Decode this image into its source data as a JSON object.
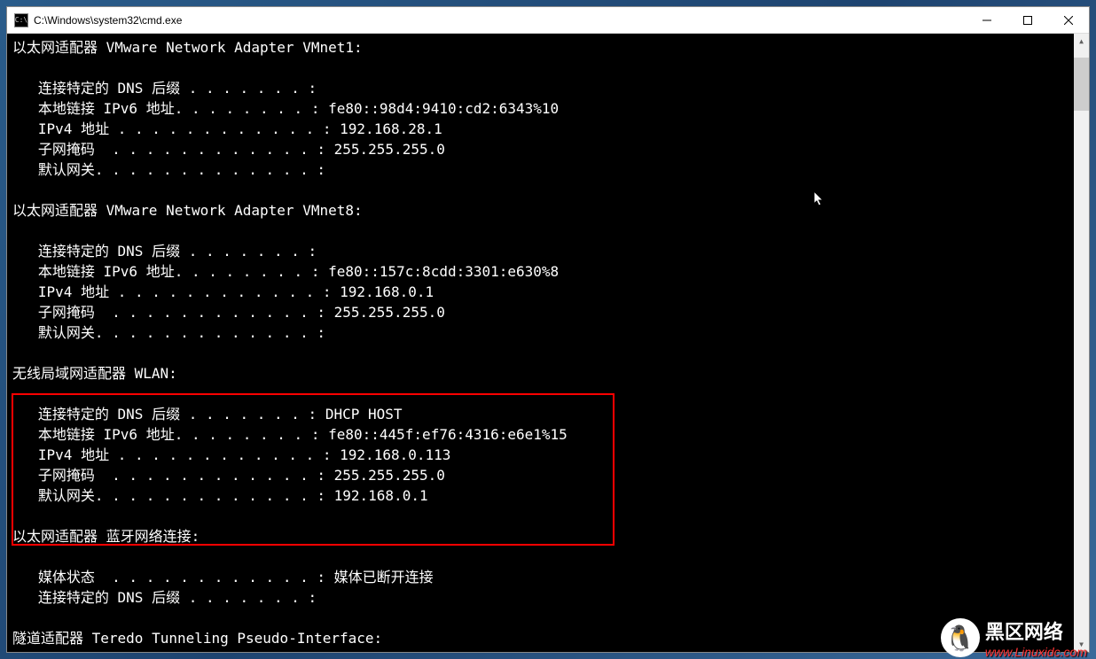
{
  "window": {
    "title": "C:\\Windows\\system32\\cmd.exe",
    "icon_label": "C:\\"
  },
  "terminal": {
    "adapter1": {
      "header": "以太网适配器 VMware Network Adapter VMnet1:",
      "dns_suffix_label": "   连接特定的 DNS 后缀 . . . . . . . :",
      "ipv6_label": "   本地链接 IPv6 地址. . . . . . . . : ",
      "ipv6_value": "fe80::98d4:9410:cd2:6343%10",
      "ipv4_label": "   IPv4 地址 . . . . . . . . . . . . : ",
      "ipv4_value": "192.168.28.1",
      "mask_label": "   子网掩码  . . . . . . . . . . . . : ",
      "mask_value": "255.255.255.0",
      "gateway_label": "   默认网关. . . . . . . . . . . . . :"
    },
    "adapter2": {
      "header": "以太网适配器 VMware Network Adapter VMnet8:",
      "dns_suffix_label": "   连接特定的 DNS 后缀 . . . . . . . :",
      "ipv6_label": "   本地链接 IPv6 地址. . . . . . . . : ",
      "ipv6_value": "fe80::157c:8cdd:3301:e630%8",
      "ipv4_label": "   IPv4 地址 . . . . . . . . . . . . : ",
      "ipv4_value": "192.168.0.1",
      "mask_label": "   子网掩码  . . . . . . . . . . . . : ",
      "mask_value": "255.255.255.0",
      "gateway_label": "   默认网关. . . . . . . . . . . . . :"
    },
    "adapter3": {
      "header": "无线局域网适配器 WLAN:",
      "dns_suffix_label": "   连接特定的 DNS 后缀 . . . . . . . : ",
      "dns_suffix_value": "DHCP HOST",
      "ipv6_label": "   本地链接 IPv6 地址. . . . . . . . : ",
      "ipv6_value": "fe80::445f:ef76:4316:e6e1%15",
      "ipv4_label": "   IPv4 地址 . . . . . . . . . . . . : ",
      "ipv4_value": "192.168.0.113",
      "mask_label": "   子网掩码  . . . . . . . . . . . . : ",
      "mask_value": "255.255.255.0",
      "gateway_label": "   默认网关. . . . . . . . . . . . . : ",
      "gateway_value": "192.168.0.1"
    },
    "adapter4": {
      "header": "以太网适配器 蓝牙网络连接:",
      "media_label": "   媒体状态  . . . . . . . . . . . . : ",
      "media_value": "媒体已断开连接",
      "dns_suffix_label": "   连接特定的 DNS 后缀 . . . . . . . :"
    },
    "adapter5": {
      "header": "隧道适配器 Teredo Tunneling Pseudo-Interface:"
    }
  },
  "watermark": {
    "title": "黑区网络",
    "sub": "www.Linuxidc.com"
  }
}
